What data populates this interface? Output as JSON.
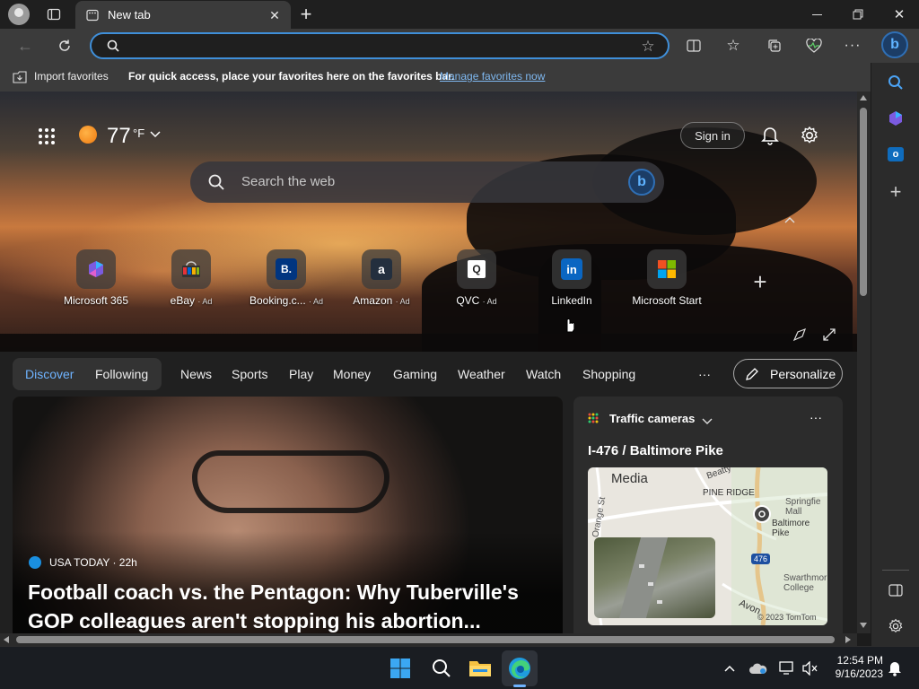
{
  "browser": {
    "tab_title": "New tab",
    "address_value": "",
    "favorites_bar": {
      "import_label": "Import favorites",
      "message": "For quick access, place your favorites here on the favorites bar.",
      "manage_link": "Manage favorites now"
    }
  },
  "header": {
    "temperature": "77",
    "unit": "°F",
    "sign_in_label": "Sign in"
  },
  "search": {
    "placeholder": "Search the web"
  },
  "quick_links": [
    {
      "label": "Microsoft 365",
      "ad": ""
    },
    {
      "label": "eBay",
      "ad": "· Ad"
    },
    {
      "label": "Booking.c...",
      "ad": "· Ad"
    },
    {
      "label": "Amazon",
      "ad": "· Ad"
    },
    {
      "label": "QVC",
      "ad": "· Ad"
    },
    {
      "label": "LinkedIn",
      "ad": ""
    },
    {
      "label": "Microsoft Start",
      "ad": ""
    }
  ],
  "feed_nav": {
    "items": [
      "Discover",
      "Following",
      "News",
      "Sports",
      "Play",
      "Money",
      "Gaming",
      "Weather",
      "Watch",
      "Shopping"
    ],
    "more": "···",
    "personalize_label": "Personalize"
  },
  "main_story": {
    "source": "USA TODAY · 22h",
    "headline": "Football coach vs. the Pentagon: Why Tuberville's GOP colleagues aren't stopping his abortion..."
  },
  "traffic_card": {
    "title": "Traffic cameras",
    "location": "I-476 / Baltimore Pike",
    "more": "···",
    "map_labels": {
      "media": "Media",
      "pine_ridge": "PINE RIDGE",
      "springfield": "Springfie\nMall",
      "baltimore_pike": "Baltimore Pike",
      "swarthmore": "Swarthmor\nCollege",
      "beatty": "Beatty",
      "orange": "Orange St",
      "route": "476",
      "copyright": "© 2023 TomTom",
      "avon": "Avon"
    }
  },
  "taskbar": {
    "time": "12:54 PM",
    "date": "9/16/2023"
  },
  "colors": {
    "accent": "#3f8fd9",
    "discover": "#6fb3ff",
    "link": "#7fb8f0"
  }
}
